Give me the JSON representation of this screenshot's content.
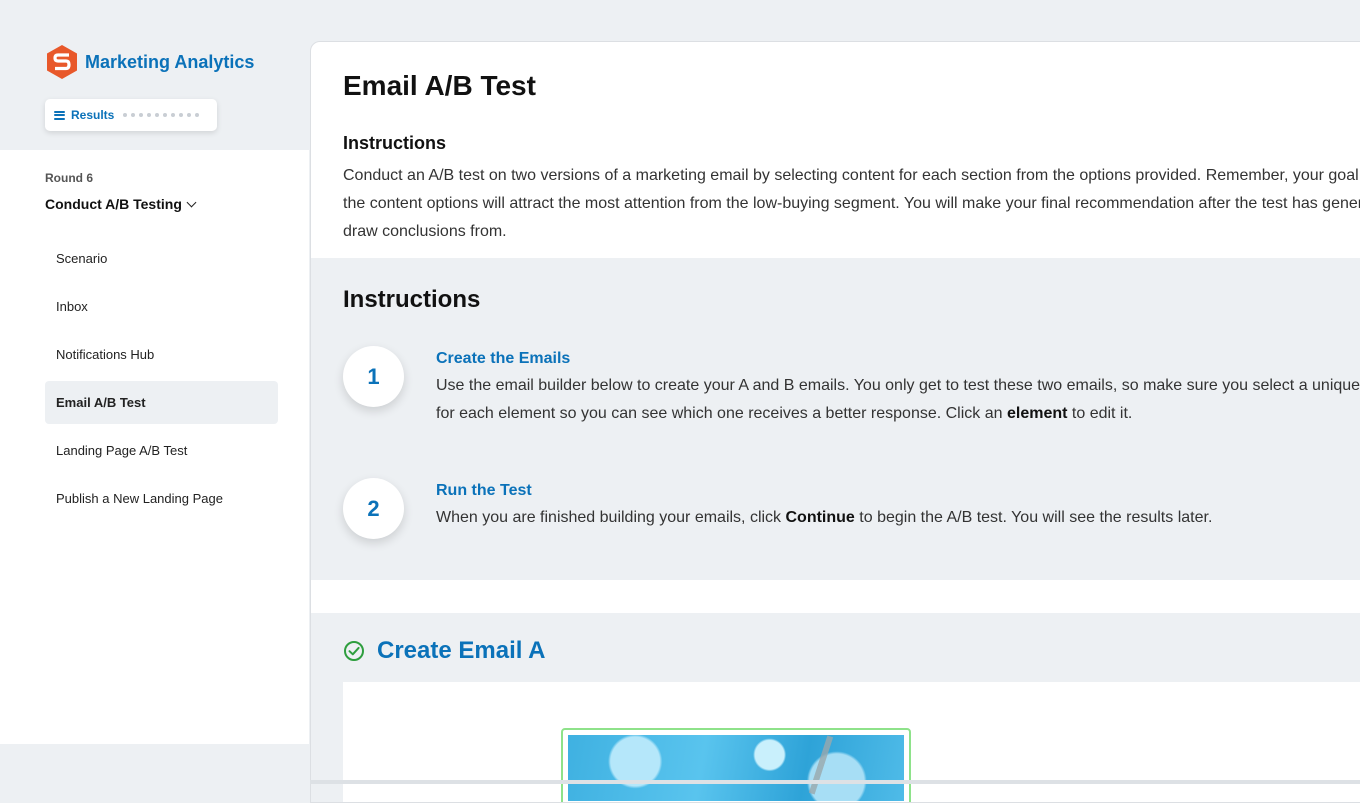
{
  "app": {
    "title": "Marketing Analytics",
    "logo_icon": "s-hexagon-logo-icon",
    "brand_color": "#0b72b9",
    "logo_color": "#e8582a"
  },
  "results_button": {
    "label": "Results"
  },
  "sidebar": {
    "round_label": "Round 6",
    "round_title": "Conduct A/B Testing",
    "items": [
      {
        "label": "Scenario",
        "active": false
      },
      {
        "label": "Inbox",
        "active": false
      },
      {
        "label": "Notifications Hub",
        "active": false
      },
      {
        "label": "Email A/B Test",
        "active": true
      },
      {
        "label": "Landing Page A/B Test",
        "active": false
      },
      {
        "label": "Publish a New Landing Page",
        "active": false
      }
    ]
  },
  "main": {
    "title": "Email A/B Test",
    "intro": {
      "heading": "Instructions",
      "text": "Conduct an A/B test on two versions of a marketing email by selecting content for each section from the options provided. Remember, your goal is to determine which of the content options will attract the most attention from the low-buying segment. You will make your final recommendation after the test has generated enough data to draw conclusions from."
    },
    "steps_heading": "Instructions",
    "steps": [
      {
        "number": "1",
        "title": "Create the Emails",
        "text_before": "Use the email builder below to create your A and B emails. You only get to test these two emails, so make sure you select a unique option for each element so you can see which one receives a better response. Click an ",
        "text_bold": "element",
        "text_after": " to edit it."
      },
      {
        "number": "2",
        "title": "Run the Test",
        "text_before": "When you are finished building your emails, click ",
        "text_bold": "Continue",
        "text_after": " to begin the A/B test. You will see the results later."
      }
    ],
    "create_email": {
      "title": "Create Email A",
      "status_icon": "check-circle-icon",
      "status_color": "#2e9e3e"
    }
  }
}
